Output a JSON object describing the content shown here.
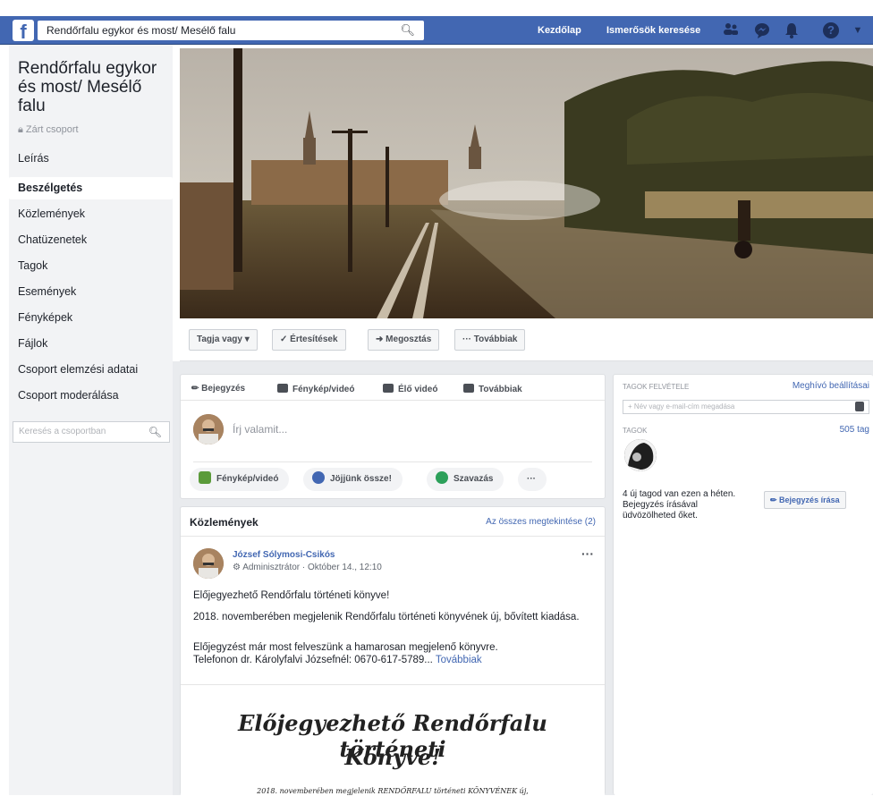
{
  "topbar": {
    "logo": "f",
    "search_value": "Rendőrfalu egykor és most/ Mesélő falu",
    "home_label": "Kezdőlap",
    "find_friends_label": "Ismerősök keresése",
    "icons": [
      "friends-icon",
      "messenger-icon",
      "notifications-icon",
      "help-icon",
      "dropdown-icon"
    ]
  },
  "sidebar": {
    "group_title": "Rendőrfalu egykor és most/ Mesélő falu",
    "privacy": "Zárt csoport",
    "items": [
      {
        "label": "Leírás",
        "active": false
      },
      {
        "label": "Beszélgetés",
        "active": true
      },
      {
        "label": "Közlemények",
        "active": false
      },
      {
        "label": "Chatüzenetek",
        "active": false
      },
      {
        "label": "Tagok",
        "active": false
      },
      {
        "label": "Események",
        "active": false
      },
      {
        "label": "Fényképek",
        "active": false
      },
      {
        "label": "Fájlok",
        "active": false
      },
      {
        "label": "Csoport elemzési adatai",
        "active": false
      },
      {
        "label": "Csoport moderálása",
        "active": false
      }
    ],
    "search_placeholder": "Keresés a csoportban"
  },
  "actions": {
    "member": "Tagja vagy ▾",
    "notifications": "✓ Értesítések",
    "share": "Megosztás",
    "more": "··· Továbbiak"
  },
  "composer": {
    "tabs": [
      "Bejegyzés",
      "Fénykép/videó",
      "Élő videó",
      "Továbbiak"
    ],
    "placeholder": "Írj valamit...",
    "pills": [
      "Fénykép/videó",
      "Jöjjünk össze!",
      "Szavazás",
      "···"
    ]
  },
  "announcements": {
    "header": "Közlemények",
    "see_all": "Az összes megtekintése (2)",
    "author": "József Sólymosi-Csikós",
    "role_time": "Adminisztrátor · Október 14., 12:10",
    "menu": "···",
    "lines": [
      "Előjegyezhető Rendőrfalu történeti könyve!",
      "2018. novemberében megjelenik Rendőrfalu történeti könyvének új, bővített kiadása.",
      "Előjegyzést már most felveszünk a hamarosan megjelenő könyvre.",
      "Telefonon dr. Károlyfalvi Józsefnél: 0670-617-5789..."
    ],
    "more_link": "Továbbiak",
    "image_title_1": "Előjegyezhető Rendőrfalu történeti",
    "image_title_2": "Könyve!",
    "image_sub": "2018. novemberében megjelenik RENDŐRFALU történeti KÖNYVÉNEK új,"
  },
  "right": {
    "add_members_label": "TAGOK FELVÉTELE",
    "invite_settings": "Meghívó beállításai",
    "add_placeholder": "+ Név vagy e-mail-cím megadása",
    "members_label": "TAGOK",
    "member_count": "505 tag",
    "new_members_text": "4 új tagod van ezen a héten. Bejegyzés írásával üdvözölheted őket.",
    "write_post": "Bejegyzés írása"
  },
  "colors": {
    "brand": "#4267b2",
    "bg": "#e9ebee",
    "link": "#4267b2"
  }
}
